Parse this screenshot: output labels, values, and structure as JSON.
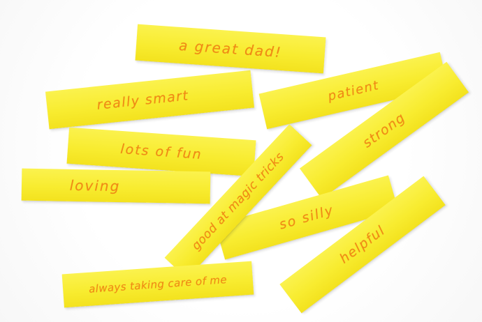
{
  "strips": [
    {
      "text": "a great dad!"
    },
    {
      "text": "really smart"
    },
    {
      "text": "patient"
    },
    {
      "text": "lots of fun"
    },
    {
      "text": "loving"
    },
    {
      "text": "strong"
    },
    {
      "text": "good at magic tricks"
    },
    {
      "text": "so silly"
    },
    {
      "text": "helpful"
    },
    {
      "text": "always taking care of me"
    }
  ],
  "colors": {
    "paper": "#f8ec30",
    "ink": "#f08a16",
    "background": "#ffffff"
  }
}
